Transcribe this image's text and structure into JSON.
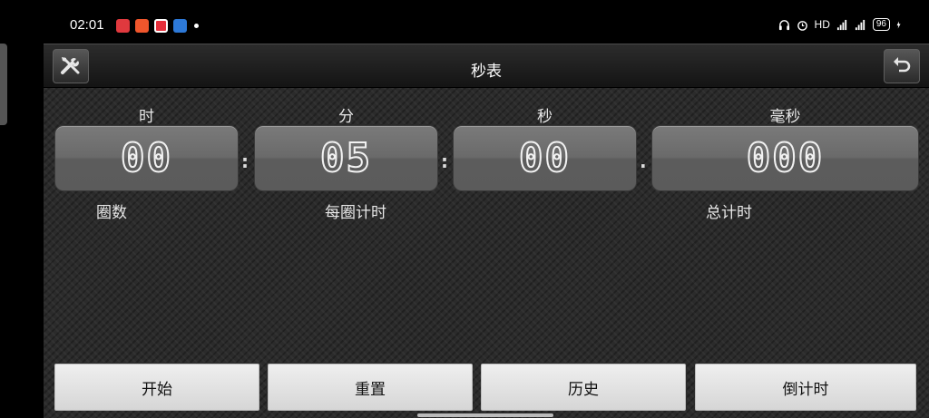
{
  "status_bar": {
    "time": "02:01",
    "network": "HD",
    "battery": "96"
  },
  "app": {
    "title": "秒表",
    "left_button_icon": "tools-icon",
    "right_button_icon": "undo-icon"
  },
  "units": [
    {
      "label": "时",
      "value": "00"
    },
    {
      "label": "分",
      "value": "05"
    },
    {
      "label": "秒",
      "value": "00"
    },
    {
      "label": "毫秒",
      "value": "000"
    }
  ],
  "separators": [
    ":",
    ":",
    "."
  ],
  "info": {
    "laps_label": "圈数",
    "lap_time_label": "每圈计时",
    "total_time_label": "总计时"
  },
  "buttons": {
    "start": "开始",
    "reset": "重置",
    "history": "历史",
    "countdown": "倒计时"
  },
  "colors": {
    "background": "#2b2b2b",
    "tile": "#6a6a6a",
    "button": "#e6e6e6"
  }
}
